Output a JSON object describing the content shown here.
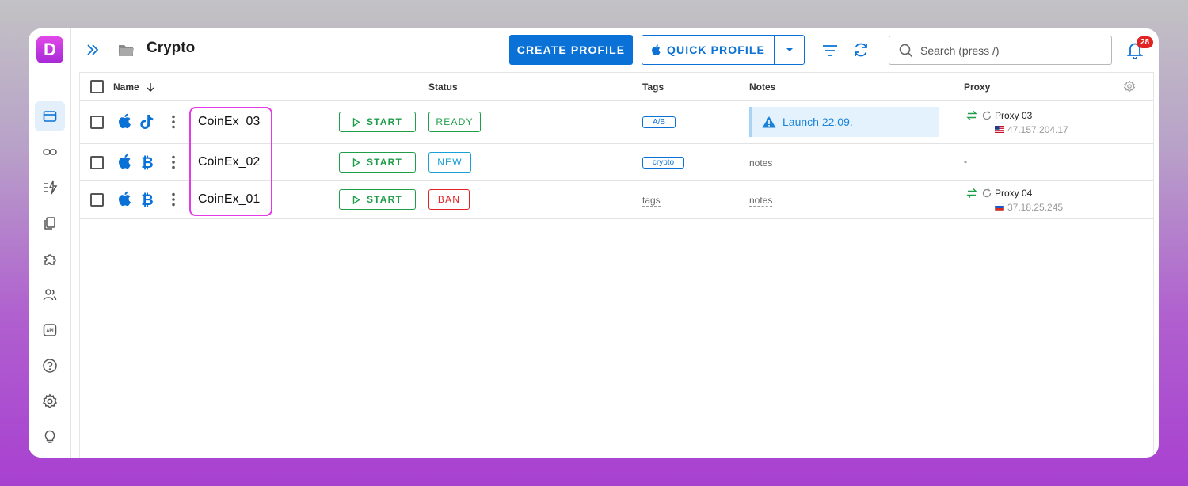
{
  "app": {
    "logo_letter": "D"
  },
  "header": {
    "title": "Crypto",
    "create_label": "CREATE PROFILE",
    "quick_label": "QUICK PROFILE",
    "search_placeholder": "Search (press /)",
    "notification_count": "28"
  },
  "sidebar": {
    "items": [
      {
        "name": "profiles",
        "icon": "browser-window-icon",
        "active": true
      },
      {
        "name": "proxies",
        "icon": "link-icon"
      },
      {
        "name": "automation",
        "icon": "zap-list-icon"
      },
      {
        "name": "templates",
        "icon": "copy-icon"
      },
      {
        "name": "extensions",
        "icon": "puzzle-icon"
      },
      {
        "name": "team",
        "icon": "users-icon"
      },
      {
        "name": "api",
        "icon": "api-icon"
      },
      {
        "name": "help",
        "icon": "help-circle-icon"
      },
      {
        "name": "settings",
        "icon": "gear-icon"
      },
      {
        "name": "ideas",
        "icon": "lightbulb-icon"
      }
    ]
  },
  "table": {
    "columns": {
      "name": "Name",
      "status": "Status",
      "tags": "Tags",
      "notes": "Notes",
      "proxy": "Proxy"
    },
    "rows": [
      {
        "name": "CoinEx_03",
        "os_icon": "apple-icon",
        "platform_icon": "tiktok-icon",
        "start_label": "START",
        "status": "READY",
        "status_color": "#1f9e4a",
        "tag": "A/B",
        "note": "Launch 22.09.",
        "proxy_name": "Proxy 03",
        "proxy_ip": "47.157.204.17",
        "proxy_flag": "us-flag-icon"
      },
      {
        "name": "CoinEx_02",
        "os_icon": "apple-icon",
        "platform_icon": "bitcoin-icon",
        "start_label": "START",
        "status": "NEW",
        "status_color": "#1a9fd6",
        "tag": "crypto",
        "note": "notes",
        "proxy_empty": "-"
      },
      {
        "name": "CoinEx_01",
        "os_icon": "apple-icon",
        "platform_icon": "bitcoin-icon",
        "start_label": "START",
        "status": "BAN",
        "status_color": "#e02424",
        "tag": "tags",
        "note": "notes",
        "proxy_name": "Proxy 04",
        "proxy_ip": "37.18.25.245",
        "proxy_flag": "ru-flag-icon"
      }
    ]
  },
  "colors": {
    "accent": "#0a72d6",
    "highlight": "#e43be8",
    "logo_gradient": [
      "#e248e8",
      "#a52ad6"
    ]
  }
}
